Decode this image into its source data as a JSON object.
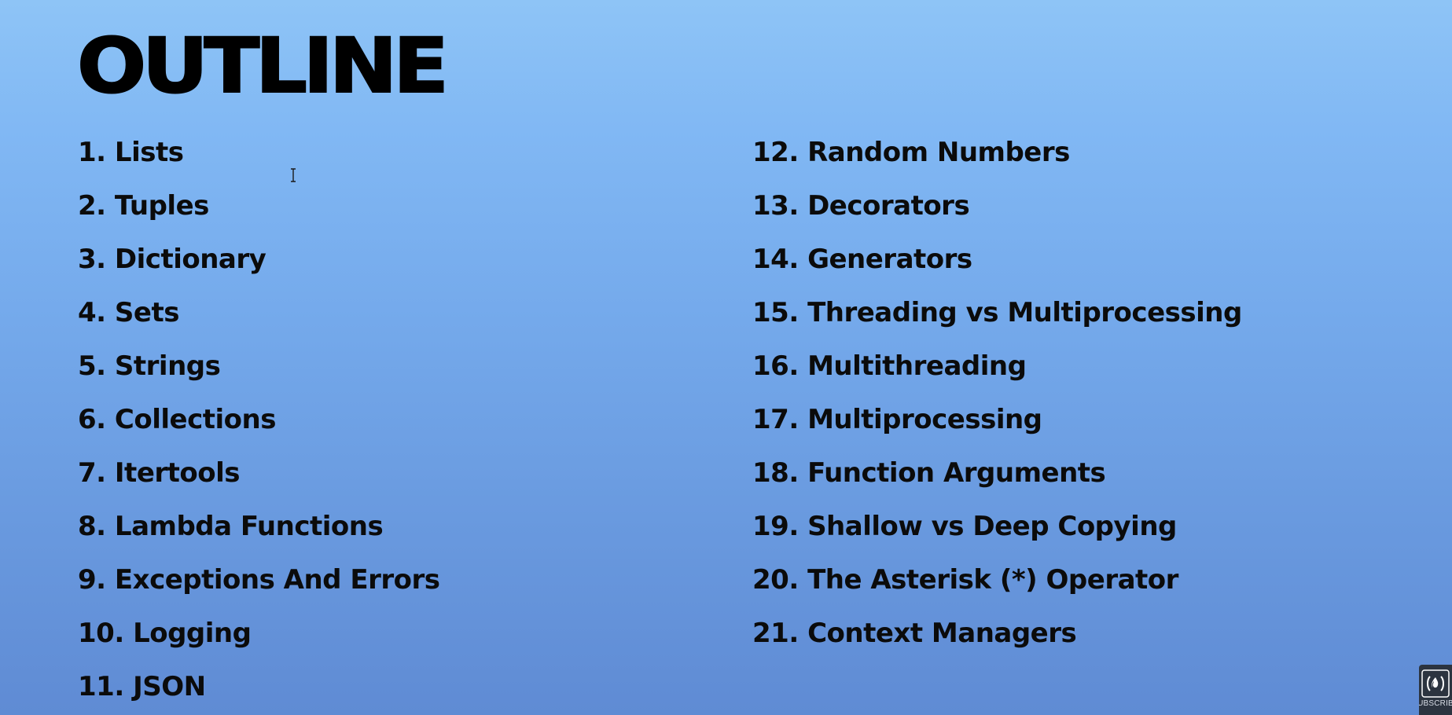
{
  "slide": {
    "title": "OUTLINE",
    "left_column": [
      "1.  Lists",
      "2. Tuples",
      "3. Dictionary",
      "4. Sets",
      "5. Strings",
      "6. Collections",
      "7. Itertools",
      "8. Lambda Functions",
      "9. Exceptions And Errors",
      "10. Logging",
      "11. JSON"
    ],
    "right_column": [
      "12. Random Numbers",
      "13. Decorators",
      "14. Generators",
      "15.  Threading vs Multiprocessing",
      "16. Multithreading",
      "17.  Multiprocessing",
      "18. Function Arguments",
      "19. Shallow vs Deep Copying",
      "20. The Asterisk (*) Operator",
      "21. Context Managers"
    ]
  },
  "overlay": {
    "subscribe_label": "SUBSCRIBE",
    "logo_icon": "freecodecamp-logo-icon",
    "cursor_icon": "text-cursor-icon"
  }
}
